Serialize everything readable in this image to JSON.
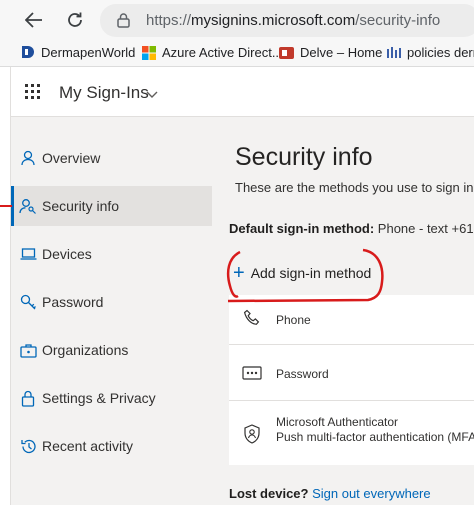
{
  "browser": {
    "url_scheme": "https://",
    "url_host": "mysignins.microsoft.com",
    "url_path": "/security-info",
    "bookmarks": [
      {
        "label": "DermapenWorld",
        "icon": "dermapen-logo-icon"
      },
      {
        "label": "Azure Active Direct...",
        "icon": "microsoft-logo-icon"
      },
      {
        "label": "Delve – Home",
        "icon": "office-logo-icon"
      },
      {
        "label": "policies derm",
        "icon": "sharepoint-logo-icon"
      }
    ]
  },
  "header": {
    "app_title": "My Sign-Ins"
  },
  "sidebar": {
    "items": [
      {
        "label": "Overview",
        "icon": "person-icon",
        "active": false
      },
      {
        "label": "Security info",
        "icon": "person-key-icon",
        "active": true
      },
      {
        "label": "Devices",
        "icon": "laptop-icon",
        "active": false
      },
      {
        "label": "Password",
        "icon": "key-icon",
        "active": false
      },
      {
        "label": "Organizations",
        "icon": "briefcase-icon",
        "active": false
      },
      {
        "label": "Settings & Privacy",
        "icon": "lock-icon",
        "active": false
      },
      {
        "label": "Recent activity",
        "icon": "history-icon",
        "active": false
      }
    ]
  },
  "main": {
    "title": "Security info",
    "subtitle": "These are the methods you use to sign in",
    "default_label": "Default sign-in method:",
    "default_value": "Phone - text +61",
    "add_label": "Add sign-in method",
    "methods": [
      {
        "label": "Phone",
        "icon": "phone-icon"
      },
      {
        "label": "Password",
        "icon": "password-dots-icon"
      },
      {
        "label": "Microsoft Authenticator",
        "detail": "Push multi-factor authentication (MFA)",
        "icon": "authenticator-icon"
      }
    ],
    "lost_device_label": "Lost device?",
    "lost_device_link": "Sign out everywhere"
  },
  "colors": {
    "accent": "#0067b8",
    "annotation": "#d81b1b",
    "sidebar_bg": "#f3f2f1"
  }
}
